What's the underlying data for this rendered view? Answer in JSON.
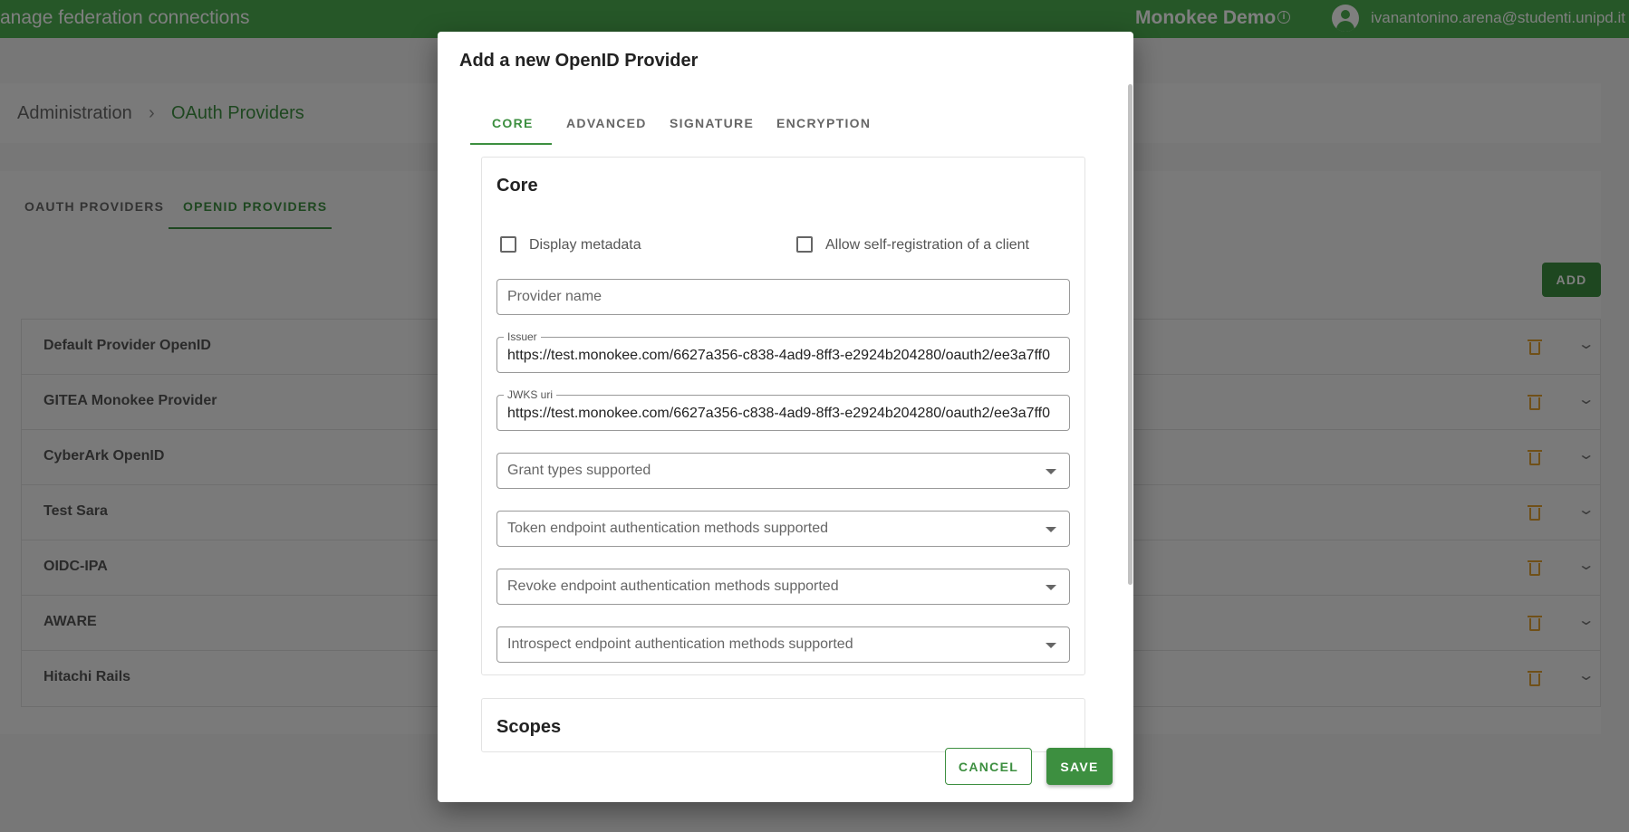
{
  "appbar": {
    "title": "anage federation connections",
    "org": "Monokee Demo",
    "info_symbol": "i",
    "user_email": "ivanantonino.arena@studenti.unipd.it"
  },
  "breadcrumb": {
    "root": "Administration",
    "separator": "›",
    "current": "OAuth Providers"
  },
  "tabs": {
    "oauth": "OAUTH PROVIDERS",
    "openid": "OPENID PROVIDERS"
  },
  "add_label": "ADD",
  "providers": [
    {
      "name": "Default Provider OpenID"
    },
    {
      "name": "GITEA Monokee Provider"
    },
    {
      "name": "CyberArk OpenID"
    },
    {
      "name": "Test Sara"
    },
    {
      "name": "OIDC-IPA"
    },
    {
      "name": "AWARE"
    },
    {
      "name": "Hitachi Rails"
    }
  ],
  "chevron": "⌄",
  "colors": {
    "appbar": "#4caf50",
    "accent": "#3d8f40",
    "delete": "#e0a030"
  },
  "dialog": {
    "title": "Add a new OpenID Provider",
    "tabs": [
      "CORE",
      "ADVANCED",
      "SIGNATURE",
      "ENCRYPTION"
    ],
    "core": {
      "title": "Core",
      "display_metadata": "Display metadata",
      "allow_self_registration": "Allow self-registration of a client",
      "provider_name_placeholder": "Provider name",
      "issuer_label": "Issuer",
      "issuer_value": "https://test.monokee.com/6627a356-c838-4ad9-8ff3-e2924b204280/oauth2/ee3a7ff0",
      "jwks_label": "JWKS uri",
      "jwks_value": "https://test.monokee.com/6627a356-c838-4ad9-8ff3-e2924b204280/oauth2/ee3a7ff0",
      "grant_types": "Grant types supported",
      "token_auth": "Token endpoint authentication methods supported",
      "revoke_auth": "Revoke endpoint authentication methods supported",
      "introspect_auth": "Introspect endpoint authentication methods supported"
    },
    "scopes_title": "Scopes",
    "cancel": "CANCEL",
    "save": "SAVE"
  }
}
